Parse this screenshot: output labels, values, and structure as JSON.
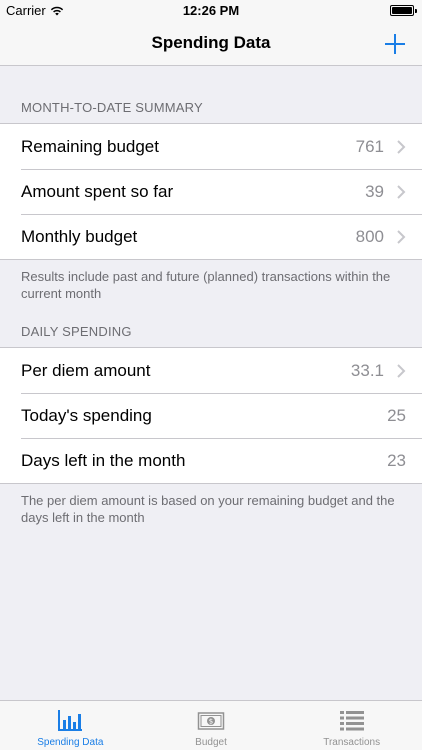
{
  "status_bar": {
    "carrier": "Carrier",
    "time": "12:26 PM"
  },
  "nav": {
    "title": "Spending Data",
    "add_icon": "plus-icon"
  },
  "summary_section": {
    "header": "MONTH-TO-DATE SUMMARY",
    "rows": [
      {
        "label": "Remaining budget",
        "value": "761"
      },
      {
        "label": "Amount spent so far",
        "value": "39"
      },
      {
        "label": "Monthly budget",
        "value": "800"
      }
    ],
    "footer": "Results include past and future (planned) transactions within the current month"
  },
  "daily_section": {
    "header": "DAILY SPENDING",
    "rows": [
      {
        "label": "Per diem amount",
        "value": "33.1"
      },
      {
        "label": "Today's spending",
        "value": "25"
      },
      {
        "label": "Days left in the month",
        "value": "23"
      }
    ],
    "footer": "The per diem amount is based on your remaining budget and the days left in the month"
  },
  "tabs": [
    {
      "label": "Spending Data",
      "icon": "bar-chart-icon",
      "active": true
    },
    {
      "label": "Budget",
      "icon": "banknote-icon",
      "active": false
    },
    {
      "label": "Transactions",
      "icon": "list-icon",
      "active": false
    }
  ],
  "colors": {
    "accent": "#1a7ee6",
    "background": "#efeff4",
    "secondary_text": "#8e8e93",
    "inactive_tab": "#929292"
  }
}
